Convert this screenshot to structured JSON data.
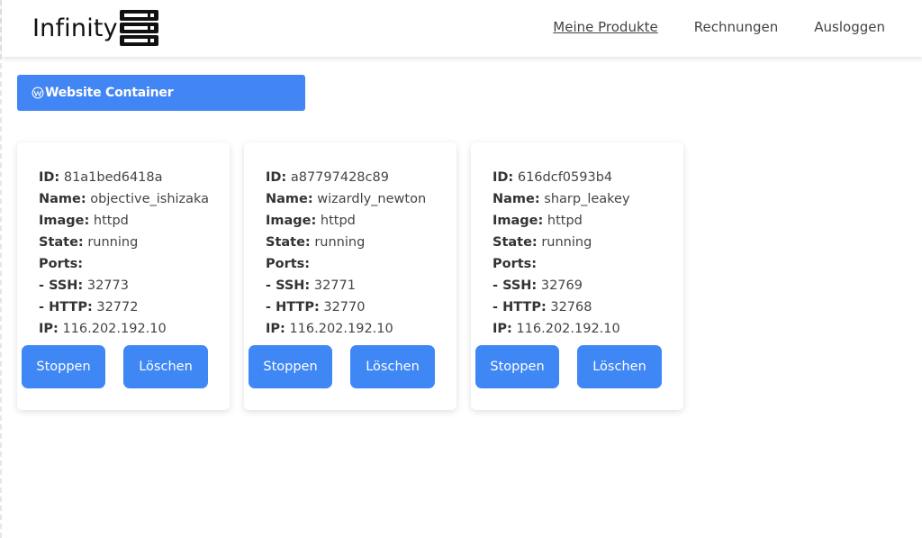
{
  "header": {
    "logo_text": "Infinity",
    "logo_icon": "server-rack-icon",
    "nav": [
      {
        "label": "Meine Produkte",
        "active": true
      },
      {
        "label": "Rechnungen",
        "active": false
      },
      {
        "label": "Ausloggen",
        "active": false
      }
    ]
  },
  "section": {
    "icon": "wordpress-icon",
    "title": "Website Container"
  },
  "labels": {
    "id": "ID:",
    "name": "Name:",
    "image": "Image:",
    "state": "State:",
    "ports": "Ports:",
    "ssh": "- SSH:",
    "http": "- HTTP:",
    "ip": "IP:"
  },
  "containers": [
    {
      "id": "81a1bed6418a",
      "name": "objective_ishizaka",
      "image": "httpd",
      "state": "running",
      "ssh": "32773",
      "http": "32772",
      "ip": "116.202.192.10",
      "stop_label": "Stoppen",
      "delete_label": "Löschen"
    },
    {
      "id": "a87797428c89",
      "name": "wizardly_newton",
      "image": "httpd",
      "state": "running",
      "ssh": "32771",
      "http": "32770",
      "ip": "116.202.192.10",
      "stop_label": "Stoppen",
      "delete_label": "Löschen"
    },
    {
      "id": "616dcf0593b4",
      "name": "sharp_leakey",
      "image": "httpd",
      "state": "running",
      "ssh": "32769",
      "http": "32768",
      "ip": "116.202.192.10",
      "stop_label": "Stoppen",
      "delete_label": "Löschen"
    }
  ],
  "colors": {
    "primary": "#4285f4",
    "button": "#3f87f5"
  }
}
